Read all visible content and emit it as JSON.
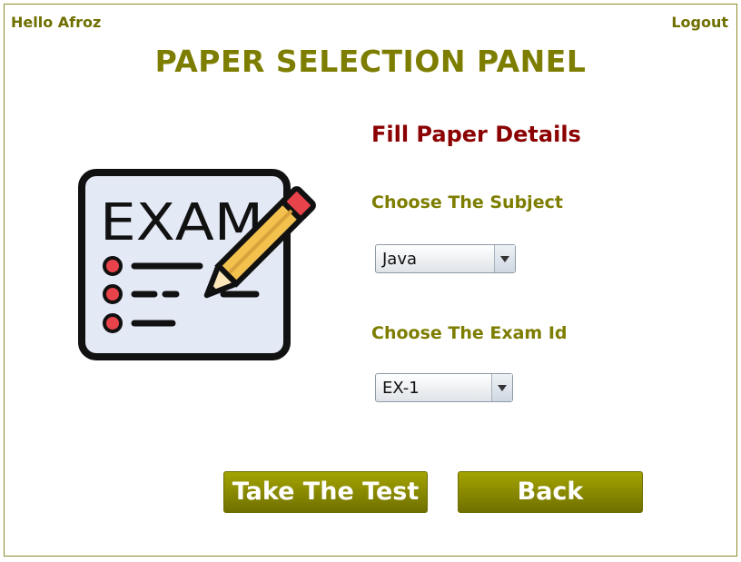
{
  "header": {
    "greeting": "Hello Afroz",
    "logout_label": "Logout",
    "title": "PAPER SELECTION PANEL"
  },
  "illustration": {
    "icon": "exam-paper-pencil-icon",
    "text": "EXAM"
  },
  "form": {
    "heading": "Fill Paper Details",
    "subject_label": "Choose The Subject",
    "subject_value": "Java",
    "exam_id_label": "Choose The Exam Id",
    "exam_id_value": "EX-1"
  },
  "actions": {
    "take_test_label": "Take The Test",
    "back_label": "Back"
  },
  "colors": {
    "brand_olive": "#7d7d00",
    "heading_red": "#8b0000",
    "exam_card_bg": "#e4e9f6",
    "pencil_yellow": "#f2c14e",
    "bullet_red": "#e8434a"
  }
}
